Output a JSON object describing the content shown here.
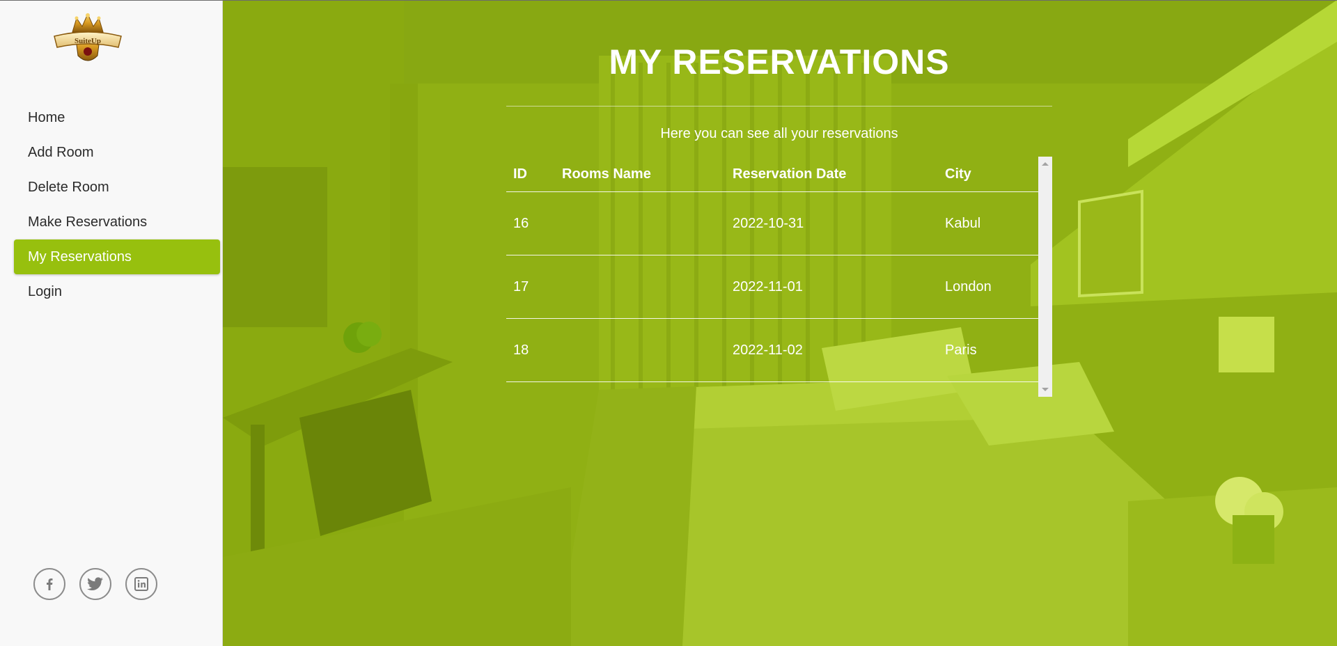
{
  "brand": {
    "logo_text": "SuiteUp"
  },
  "sidebar": {
    "items": [
      {
        "label": "Home"
      },
      {
        "label": "Add Room"
      },
      {
        "label": "Delete Room"
      },
      {
        "label": "Make Reservations"
      },
      {
        "label": "My Reservations",
        "active": true
      },
      {
        "label": "Login"
      }
    ],
    "social": [
      "facebook-icon",
      "twitter-icon",
      "linkedin-icon"
    ]
  },
  "main": {
    "title": "MY RESERVATIONS",
    "subtitle": "Here you can see all your reservations",
    "table": {
      "headers": [
        "ID",
        "Rooms Name",
        "Reservation Date",
        "City"
      ],
      "rows": [
        [
          "16",
          "",
          "2022-10-31",
          "Kabul"
        ],
        [
          "17",
          "",
          "2022-11-01",
          "London"
        ],
        [
          "18",
          "",
          "2022-11-02",
          "Paris"
        ]
      ]
    }
  },
  "colors": {
    "accent": "#97c00e",
    "overlay": "#90b014",
    "sidebar_bg": "#f8f8f8"
  }
}
